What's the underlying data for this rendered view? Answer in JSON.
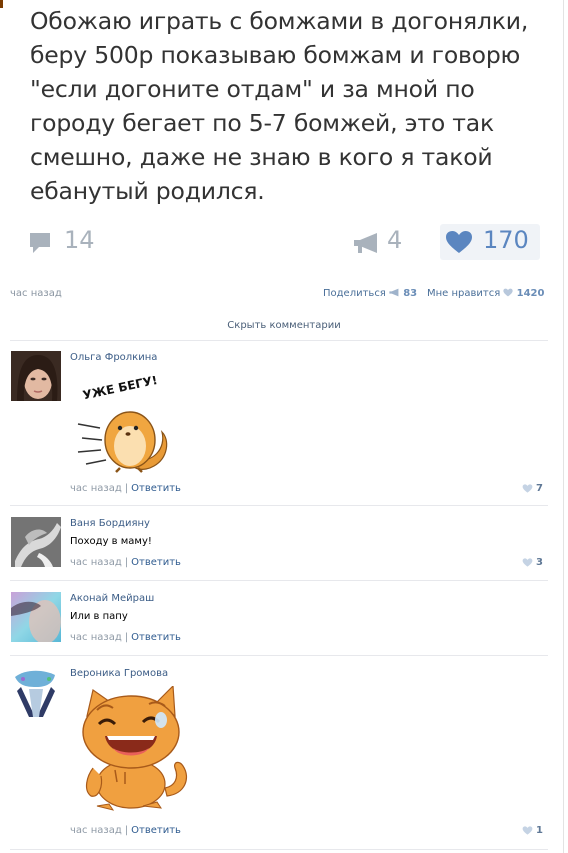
{
  "post": {
    "lines": [
      "Обожаю играть с бомжами в догонялки,",
      "беру 500р показываю бомжам и говорю",
      "\"если догоните отдам\" и за мной по",
      "городу бегает по 5-7 бомжей, это так",
      "смешно, даже не знаю в кого я такой",
      "ебанутый родился."
    ],
    "comments_count": "14",
    "reposts_count": "4",
    "likes_count": "170"
  },
  "meta": {
    "time": "час назад",
    "share_label": "Поделиться",
    "share_count": "83",
    "like_label": "Мне нравится",
    "like_count": "1420",
    "hide_comments": "Скрыть комментарии"
  },
  "comments": [
    {
      "author": "Ольга Фролкина",
      "text": "",
      "sticker_text": "УЖЕ БЕГУ!",
      "time": "час назад",
      "reply": "Ответить",
      "likes": "7"
    },
    {
      "author": "Ваня Бордияну",
      "text": "Походу в маму!",
      "time": "час назад",
      "reply": "Ответить",
      "likes": "3"
    },
    {
      "author": "Аконай Мейраш",
      "text": "Или в папу",
      "time": "час назад",
      "reply": "Ответить",
      "likes": ""
    },
    {
      "author": "Вероника Громова",
      "text": "",
      "time": "час назад",
      "reply": "Ответить",
      "likes": "1"
    }
  ],
  "icons": {
    "comment": "speech-bubble-icon",
    "repost": "megaphone-icon",
    "like": "heart-icon"
  },
  "colors": {
    "link": "#2f5b8f",
    "like_blue": "#5b86c0",
    "muted": "#a9b2bc"
  }
}
